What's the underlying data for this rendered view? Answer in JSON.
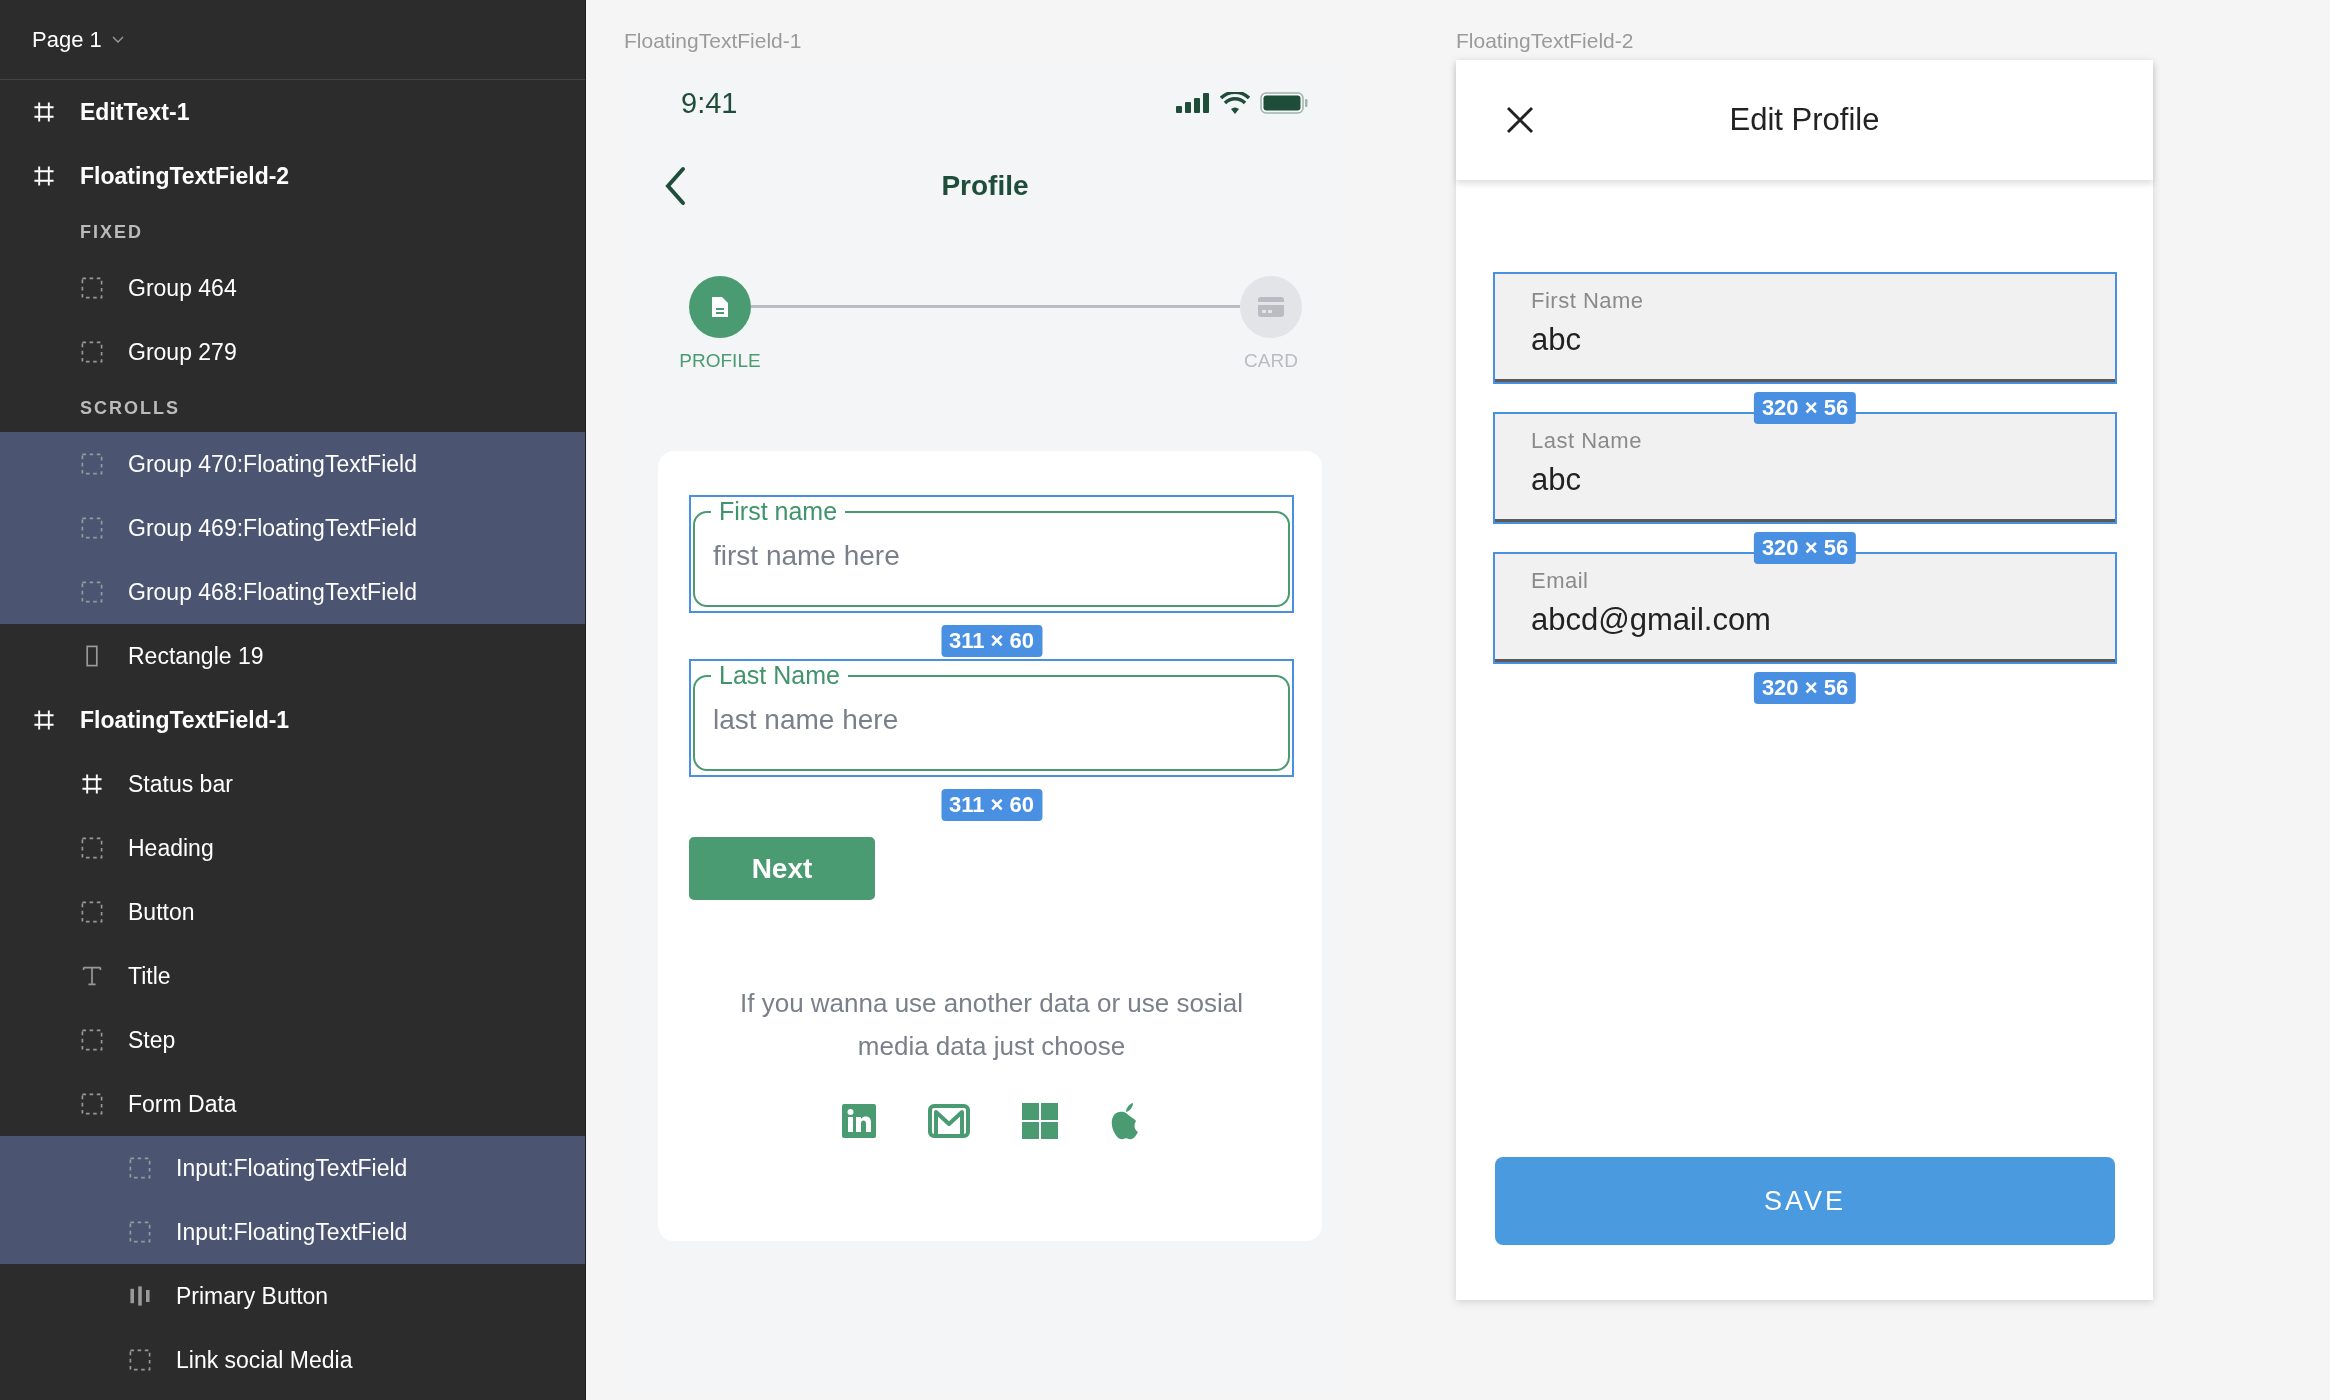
{
  "sidebar": {
    "page": {
      "label": "Page 1"
    },
    "layers": [
      {
        "label": "EditText-1",
        "kind": "frame",
        "selected": false
      },
      {
        "label": "FloatingTextField-2",
        "kind": "frame",
        "selected": false,
        "children": [
          {
            "label": "FIXED",
            "kind": "section",
            "selected": false
          },
          {
            "label": "Group 464",
            "kind": "group",
            "selected": false
          },
          {
            "label": "Group 279",
            "kind": "group",
            "selected": false
          },
          {
            "label": "SCROLLS",
            "kind": "section",
            "selected": false
          },
          {
            "label": "Group 470:FloatingTextField",
            "kind": "group",
            "selected": true
          },
          {
            "label": "Group 469:FloatingTextField",
            "kind": "group",
            "selected": true
          },
          {
            "label": "Group 468:FloatingTextField",
            "kind": "group",
            "selected": true
          },
          {
            "label": "Rectangle 19",
            "kind": "rectangle",
            "selected": false
          }
        ]
      },
      {
        "label": "FloatingTextField-1",
        "kind": "frame",
        "selected": false,
        "children": [
          {
            "label": "Status bar",
            "kind": "frame",
            "selected": false
          },
          {
            "label": "Heading",
            "kind": "group",
            "selected": false
          },
          {
            "label": "Button",
            "kind": "group",
            "selected": false
          },
          {
            "label": "Title",
            "kind": "text",
            "selected": false
          },
          {
            "label": "Step",
            "kind": "group",
            "selected": false
          },
          {
            "label": "Form Data",
            "kind": "group",
            "selected": false,
            "children": [
              {
                "label": "Input:FloatingTextField",
                "kind": "group",
                "selected": true
              },
              {
                "label": "Input:FloatingTextField",
                "kind": "group",
                "selected": true
              },
              {
                "label": "Primary Button",
                "kind": "stack",
                "selected": false
              },
              {
                "label": "Link social Media",
                "kind": "group",
                "selected": false
              }
            ]
          }
        ]
      }
    ]
  },
  "profile_frame": {
    "frame_label": "FloatingTextField-1",
    "status_bar": {
      "time": "9:41"
    },
    "title": "Profile",
    "steps": [
      {
        "label": "PROFILE",
        "kind": "document",
        "selected": true
      },
      {
        "label": "CARD",
        "kind": "card",
        "selected": false
      }
    ],
    "fields": [
      {
        "label": "First name",
        "placeholder": "first name here",
        "selected": true,
        "size_label": "311 × 60"
      },
      {
        "label": "Last Name",
        "placeholder": "last name here",
        "selected": true,
        "size_label": "311 × 60"
      }
    ],
    "next_button": "Next",
    "hint": "If you wanna use another data or use sosial media data just choose",
    "social": [
      {
        "kind": "linkedin"
      },
      {
        "kind": "mail"
      },
      {
        "kind": "windows"
      },
      {
        "kind": "apple"
      }
    ]
  },
  "edit_frame": {
    "frame_label": "FloatingTextField-2",
    "title": "Edit Profile",
    "fields": [
      {
        "label": "First Name",
        "value": "abc",
        "selected": true,
        "size_label": "320 × 56"
      },
      {
        "label": "Last Name",
        "value": "abc",
        "selected": true,
        "size_label": "320 × 56"
      },
      {
        "label": "Email",
        "value": "abcd@gmail.com",
        "selected": true,
        "size_label": "320 × 56"
      }
    ],
    "save_button": "SAVE"
  }
}
